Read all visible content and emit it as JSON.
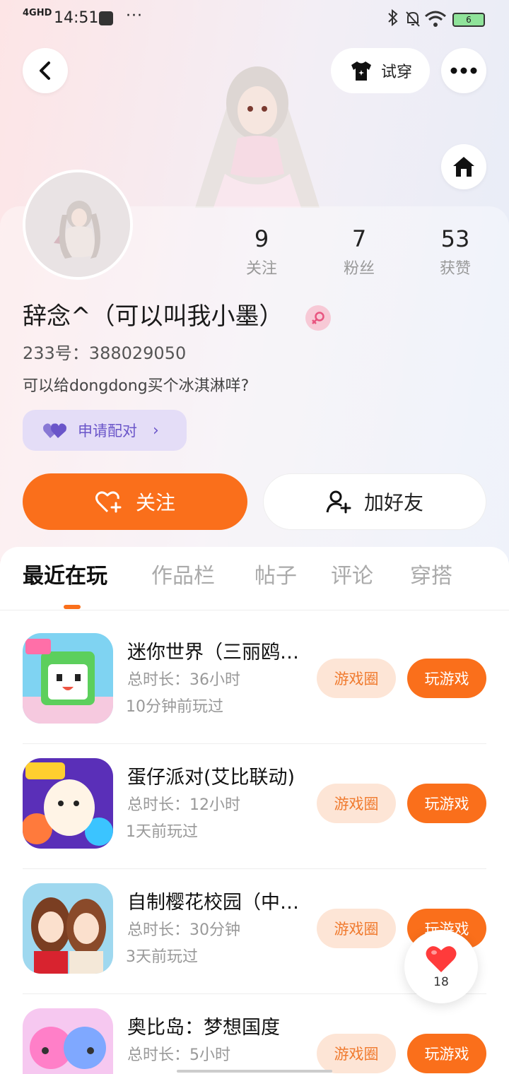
{
  "status_bar": {
    "network": "4GHD",
    "time": "14:51",
    "dots": "···",
    "battery": "6"
  },
  "header": {
    "tryon_label": "试穿"
  },
  "profile": {
    "stats": [
      {
        "value": "9",
        "label": "关注"
      },
      {
        "value": "7",
        "label": "粉丝"
      },
      {
        "value": "53",
        "label": "获赞"
      }
    ],
    "nickname": "辞念^（可以叫我小墨）",
    "account_id": "233号：388029050",
    "bio": "可以给dongdong买个冰淇淋咩?",
    "match_label": "申请配对",
    "follow_label": "关注",
    "add_friend_label": "加好友"
  },
  "tabs": [
    "最近在玩",
    "作品栏",
    "帖子",
    "评论",
    "穿搭"
  ],
  "games": [
    {
      "title": "迷你世界（三丽鸥联动）",
      "duration": "总时长：36小时",
      "last_played": "10分钟前玩过",
      "circle_label": "游戏圈",
      "play_label": "玩游戏"
    },
    {
      "title": "蛋仔派对(艾比联动)",
      "duration": "总时长：12小时",
      "last_played": "1天前玩过",
      "circle_label": "游戏圈",
      "play_label": "玩游戏"
    },
    {
      "title": "自制樱花校园（中文版）",
      "duration": "总时长：30分钟",
      "last_played": "3天前玩过",
      "circle_label": "游戏圈",
      "play_label": "玩游戏"
    },
    {
      "title": "奥比岛：梦想国度",
      "duration": "总时长：5小时",
      "last_played": "",
      "circle_label": "游戏圈",
      "play_label": "玩游戏"
    }
  ],
  "like_float": {
    "count": "18"
  },
  "colors": {
    "accent": "#fa6f1b",
    "match": "#6a55c9",
    "gender": "#e8547f"
  }
}
